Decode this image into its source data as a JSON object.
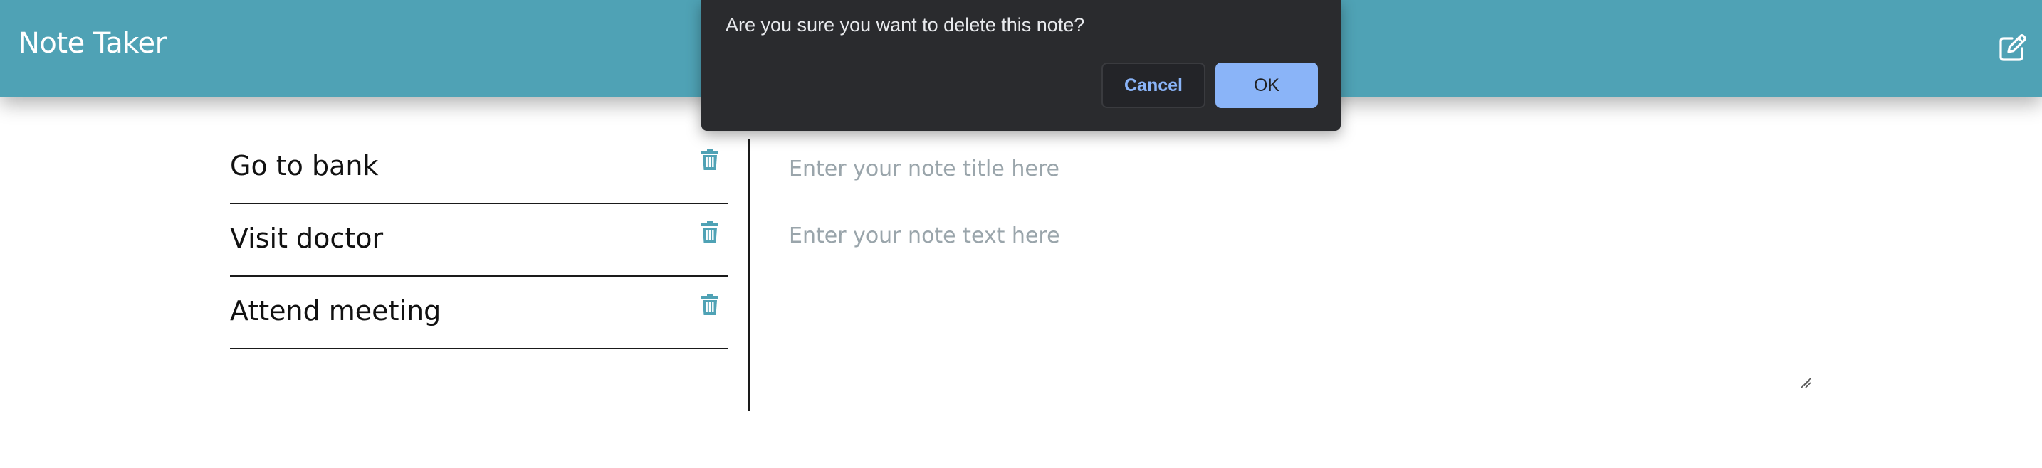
{
  "navbar": {
    "title": "Note Taker",
    "background": "#4fa2b5",
    "new_note_icon": "edit-square-icon"
  },
  "notes": [
    {
      "title": "Go to bank",
      "delete_icon": "trash-icon"
    },
    {
      "title": "Visit doctor",
      "delete_icon": "trash-icon"
    },
    {
      "title": "Attend meeting",
      "delete_icon": "trash-icon"
    }
  ],
  "editor": {
    "title_placeholder": "Enter your note title here",
    "text_placeholder": "Enter your note text here"
  },
  "dialog": {
    "message": "Are you sure you want to delete this note?",
    "cancel_label": "Cancel",
    "ok_label": "OK",
    "accent": "#8ab4f8"
  }
}
